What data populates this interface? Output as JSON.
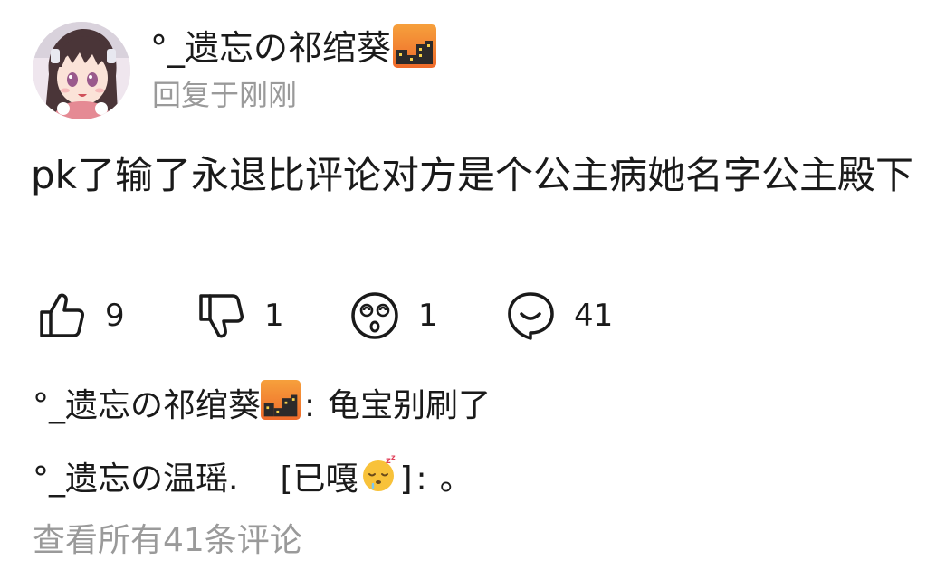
{
  "comment": {
    "username": "°_遗忘の祁绾葵",
    "reply_time": "回复于刚刚",
    "content": "pk了输了永退比评论对方是个公主病她名字公主殿下",
    "avatar_icon": "anime-girl-avatar",
    "badge_icon": "city-night-badge",
    "actions": {
      "like": {
        "icon": "thumbs-up-icon",
        "count": "9"
      },
      "dislike": {
        "icon": "thumbs-down-icon",
        "count": "1"
      },
      "dizzy": {
        "icon": "dizzy-face-icon",
        "count": "1"
      },
      "reply": {
        "icon": "speech-bubble-icon",
        "count": "41"
      }
    }
  },
  "replies": [
    {
      "name": "°_遗忘の祁绾葵",
      "has_badge": true,
      "colon": ":",
      "text": "龟宝别刷了"
    },
    {
      "name": "°_遗忘の温瑶.",
      "sticker_prefix": "[已嘎",
      "sticker_icon": "sleepy-face-icon",
      "sticker_suffix": "]",
      "colon": ":",
      "text": "。"
    }
  ],
  "view_all": "查看所有41条评论",
  "colors": {
    "text": "#1a1a1a",
    "muted": "#9a9a9a",
    "badge_orange": "#f28a2a",
    "badge_dark": "#2c2a2a"
  }
}
